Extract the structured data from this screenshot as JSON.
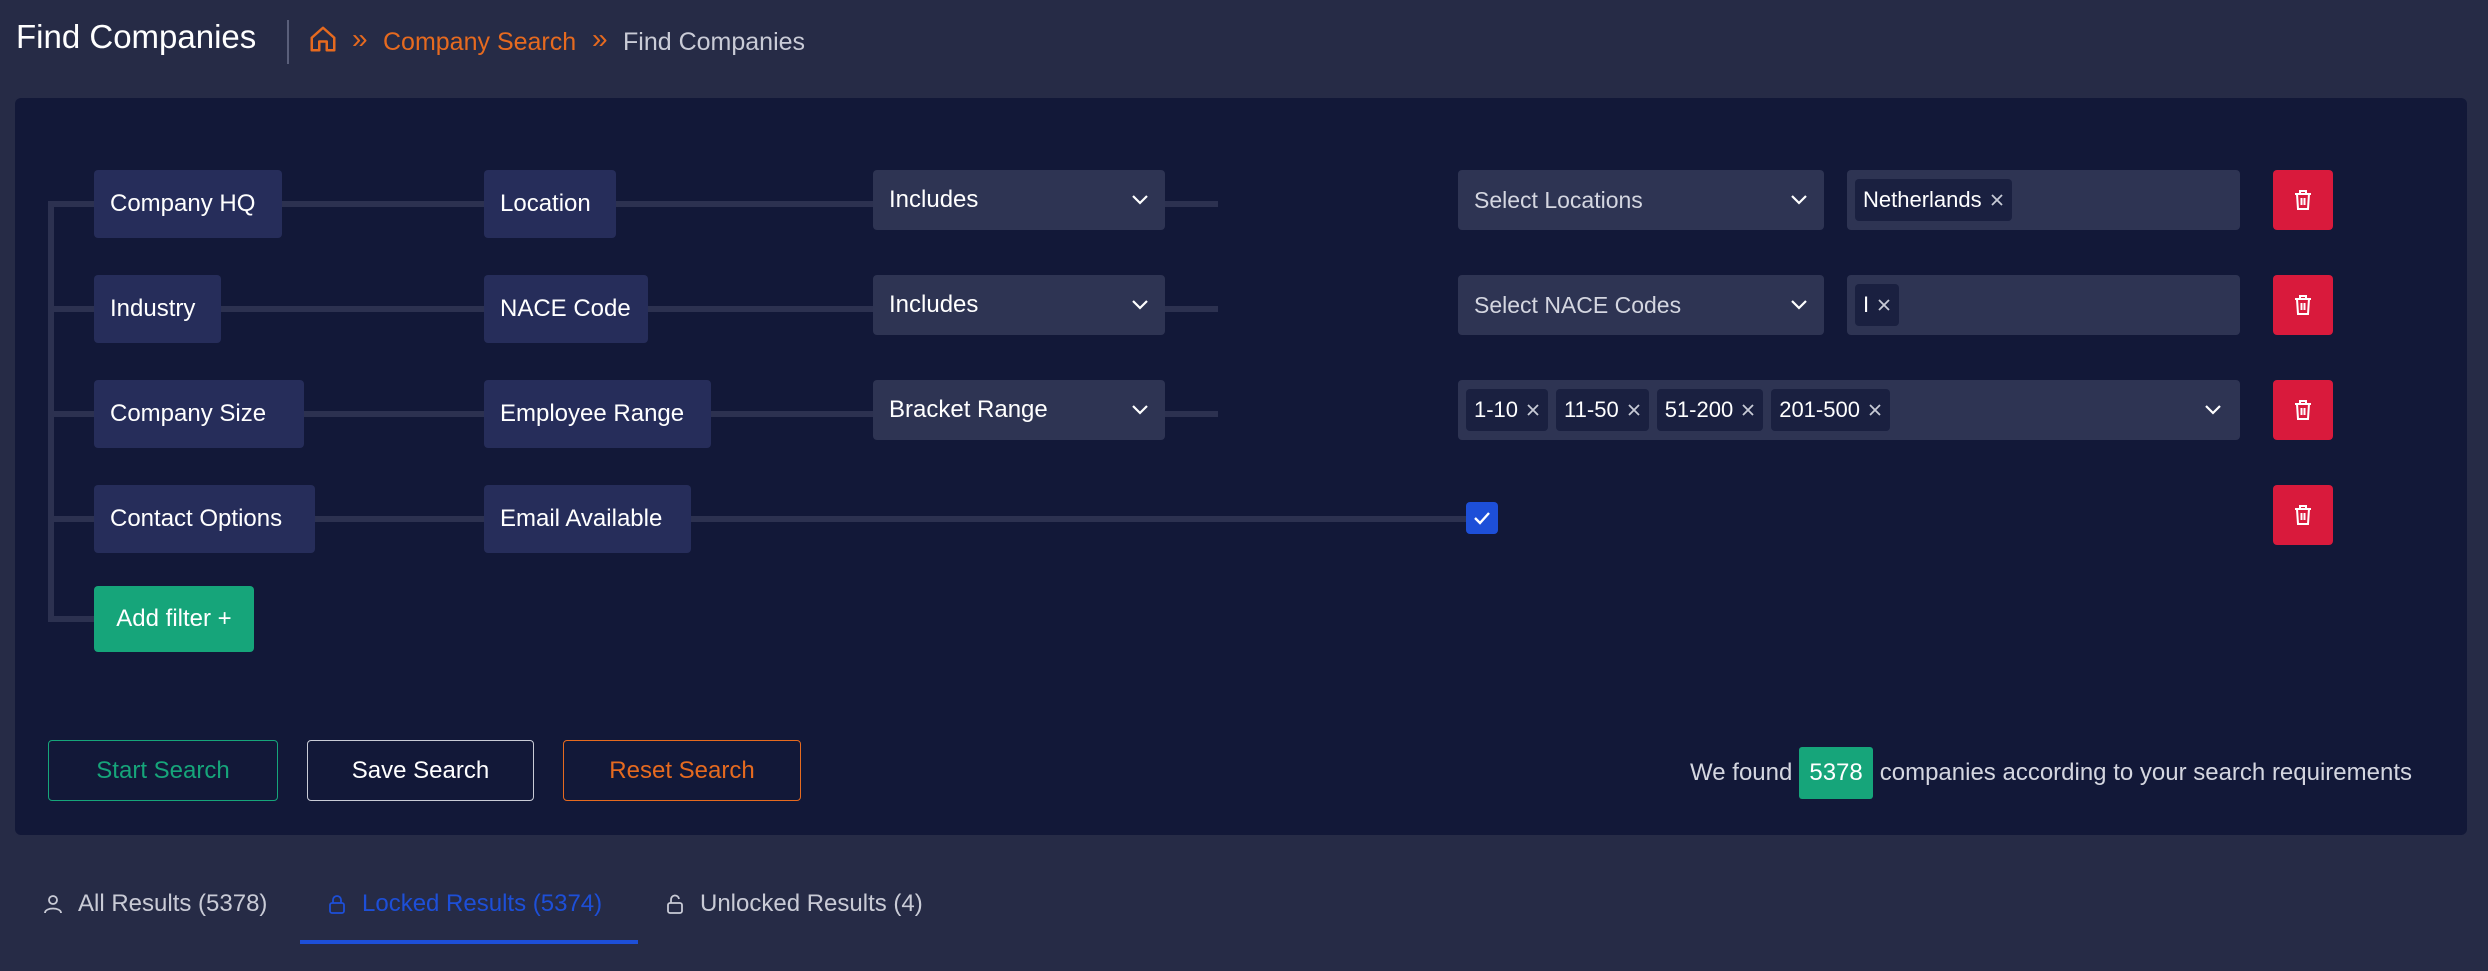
{
  "header": {
    "title": "Find Companies",
    "breadcrumb": {
      "home_icon": "home-icon",
      "separator": "»",
      "link": "Company Search",
      "current": "Find Companies"
    }
  },
  "filters": [
    {
      "category": "Company HQ",
      "field": "Location",
      "operator": "Includes",
      "select_placeholder": "Select Locations",
      "tags": [
        "Netherlands"
      ]
    },
    {
      "category": "Industry",
      "field": "NACE Code",
      "operator": "Includes",
      "select_placeholder": "Select NACE Codes",
      "tags": [
        "I"
      ]
    },
    {
      "category": "Company Size",
      "field": "Employee Range",
      "operator": "Bracket Range",
      "tags": [
        "1-10",
        "11-50",
        "51-200",
        "201-500"
      ]
    },
    {
      "category": "Contact Options",
      "field": "Email Available",
      "checked": true
    }
  ],
  "actions": {
    "add_filter": "Add filter +",
    "start_search": "Start Search",
    "save_search": "Save Search",
    "reset_search": "Reset Search"
  },
  "results_summary": {
    "prefix": "We found",
    "count": "5378",
    "suffix": "companies according to your search requirements"
  },
  "tabs": [
    {
      "label": "All Results (5378)",
      "icon": "user-icon",
      "active": false
    },
    {
      "label": "Locked Results (5374)",
      "icon": "lock-icon",
      "active": true
    },
    {
      "label": "Unlocked Results (4)",
      "icon": "unlock-icon",
      "active": false
    }
  ],
  "colors": {
    "accent_orange": "#e66a1f",
    "accent_green": "#16a57a",
    "accent_blue": "#1d4fd8",
    "danger_red": "#d91a3c",
    "panel_bg": "#121838"
  }
}
